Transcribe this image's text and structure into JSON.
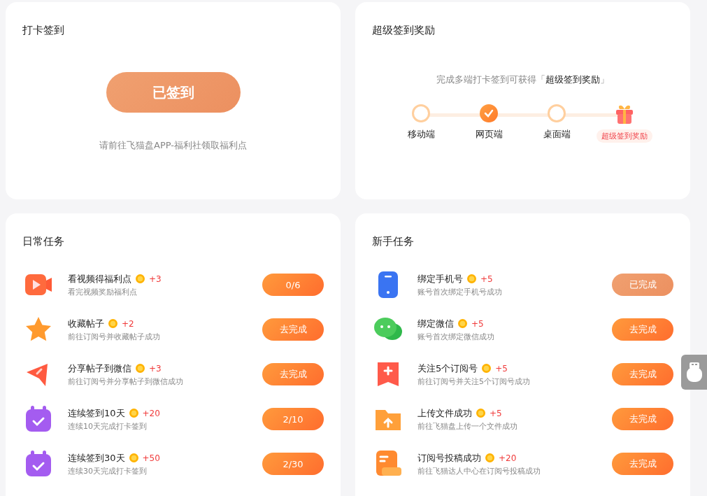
{
  "checkin": {
    "title": "打卡签到",
    "button": {
      "label": "已签到",
      "signed": true
    },
    "hint": "请前往飞猫盘APP-福利社领取福利点"
  },
  "super_reward": {
    "title": "超级签到奖励",
    "subtitle": "完成多端打卡签到可获得「**超级签到奖励**」",
    "steps": [
      {
        "kind": "device",
        "label": "移动端",
        "checked": false
      },
      {
        "kind": "device",
        "label": "网页端",
        "checked": true
      },
      {
        "kind": "device",
        "label": "桌面端",
        "checked": false
      },
      {
        "kind": "reward",
        "label": "超级签到奖励",
        "checked": false
      }
    ]
  },
  "daily_tasks": {
    "title": "日常任务",
    "tasks": [
      {
        "kind": "video",
        "title": "看视频得福利点",
        "points": "+3",
        "desc": "看完视频奖励福利点",
        "button": "0/6",
        "done": false
      },
      {
        "kind": "star",
        "title": "收藏帖子",
        "points": "+2",
        "desc": "前往订阅号并收藏帖子成功",
        "button": "去完成",
        "done": false
      },
      {
        "kind": "share",
        "title": "分享帖子到微信",
        "points": "+3",
        "desc": "前往订阅号并分享帖子到微信成功",
        "button": "去完成",
        "done": false
      },
      {
        "kind": "calendar",
        "title": "连续签到10天",
        "points": "+20",
        "desc": "连续10天完成打卡签到",
        "button": "2/10",
        "done": false
      },
      {
        "kind": "calendar",
        "title": "连续签到30天",
        "points": "+50",
        "desc": "连续30天完成打卡签到",
        "button": "2/30",
        "done": false
      }
    ]
  },
  "newbie_tasks": {
    "title": "新手任务",
    "tasks": [
      {
        "kind": "phone",
        "title": "绑定手机号",
        "points": "+5",
        "desc": "账号首次绑定手机号成功",
        "button": "已完成",
        "done": true
      },
      {
        "kind": "chat",
        "title": "绑定微信",
        "points": "+5",
        "desc": "账号首次绑定微信成功",
        "button": "去完成",
        "done": false
      },
      {
        "kind": "bookmark",
        "title": "关注5个订阅号",
        "points": "+5",
        "desc": "前往订阅号并关注5个订阅号成功",
        "button": "去完成",
        "done": false
      },
      {
        "kind": "folder",
        "title": "上传文件成功",
        "points": "+5",
        "desc": "前往飞猫盘上传一个文件成功",
        "button": "去完成",
        "done": false
      },
      {
        "kind": "document",
        "title": "订阅号投稿成功",
        "points": "+20",
        "desc": "前往飞猫达人中心在订阅号投稿成功",
        "button": "去完成",
        "done": false
      }
    ]
  }
}
